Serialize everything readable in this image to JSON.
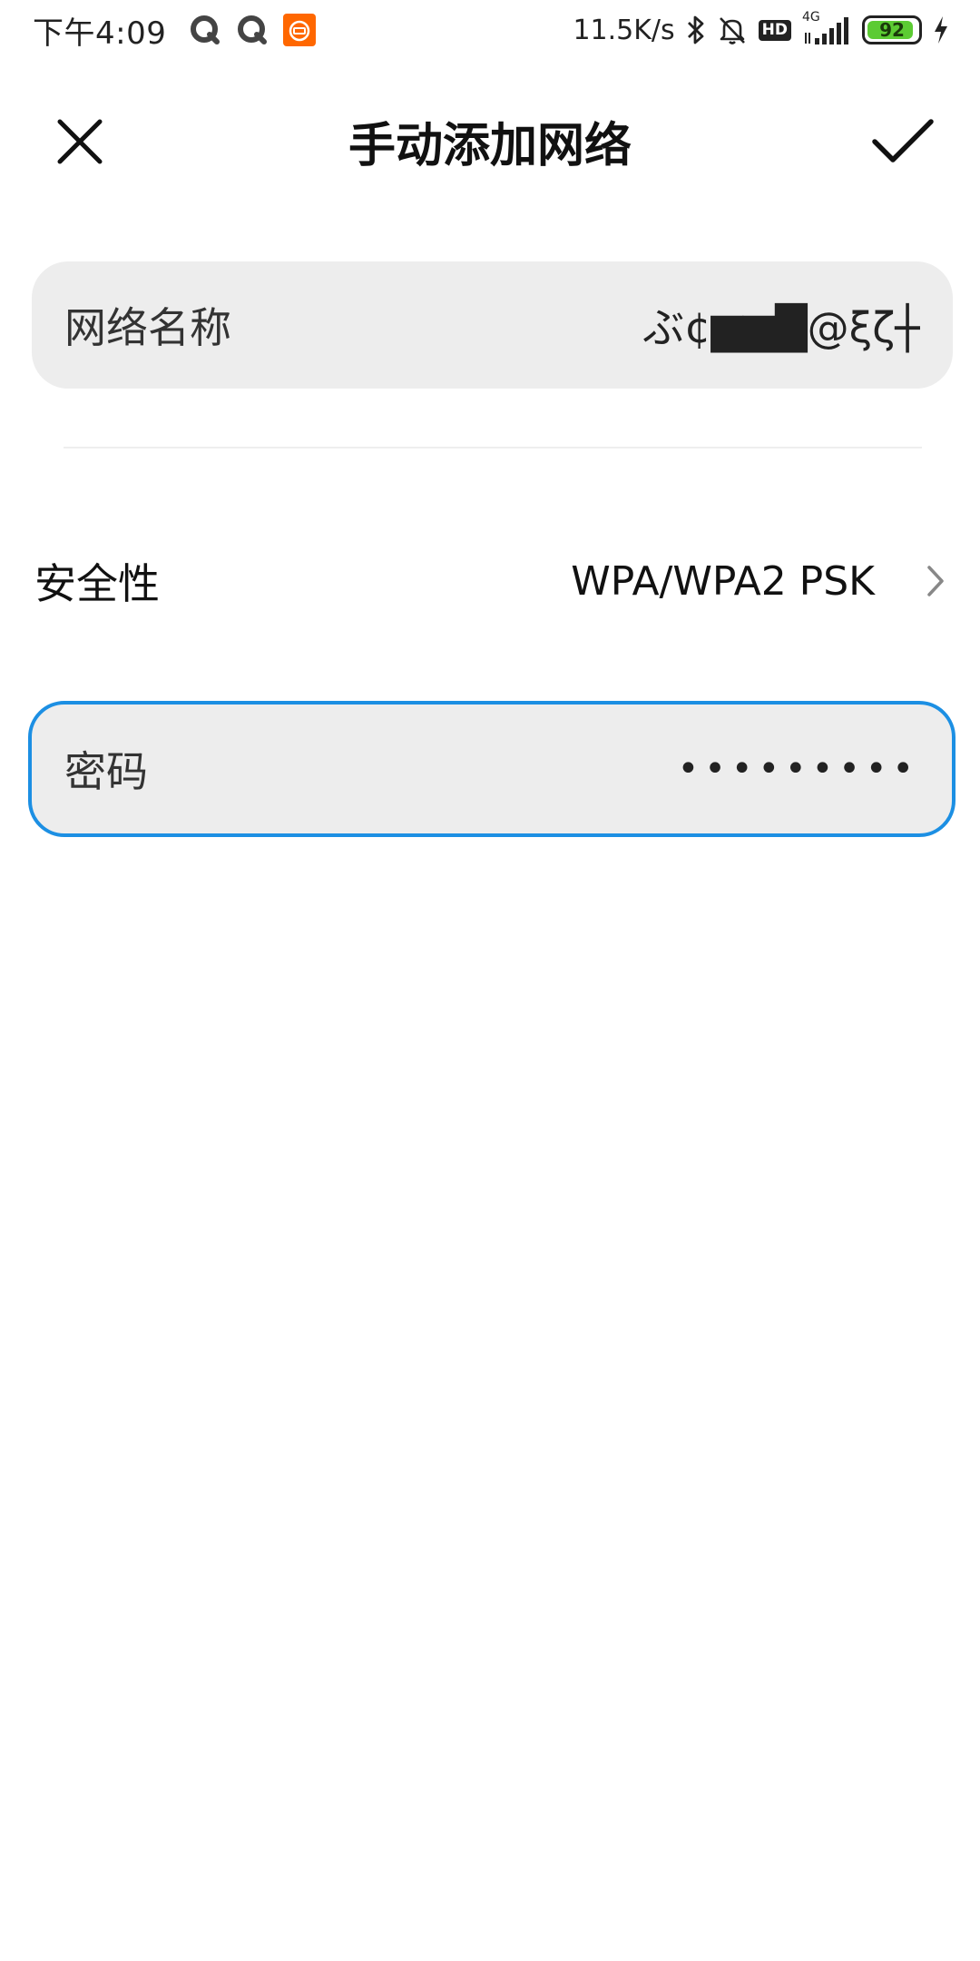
{
  "status_bar": {
    "time": "下午4:09",
    "network_speed": "11.5K/s",
    "hd_badge": "HD",
    "network_type": "4G",
    "battery_level": "92",
    "battery_fraction": 0.92,
    "icons": [
      "chat-app-icon",
      "chat-app-icon",
      "mi-app-icon",
      "bluetooth-icon",
      "mute-bell-icon",
      "signal-icon",
      "charging-icon"
    ],
    "colors": {
      "battery_fill": "#5ccb33",
      "mi_app": "#ff6700"
    }
  },
  "header": {
    "title": "手动添加网络",
    "close_icon": "close-icon",
    "confirm_icon": "check-icon"
  },
  "form": {
    "ssid": {
      "label": "网络名称",
      "value": "ぶ¢▆▆█@ξζ┼"
    },
    "security": {
      "label": "安全性",
      "value": "WPA/WPA2 PSK",
      "icon": "chevron-right-icon"
    },
    "password": {
      "label": "密码",
      "value": "•••••••••",
      "focus_color": "#1c8fe3"
    }
  }
}
